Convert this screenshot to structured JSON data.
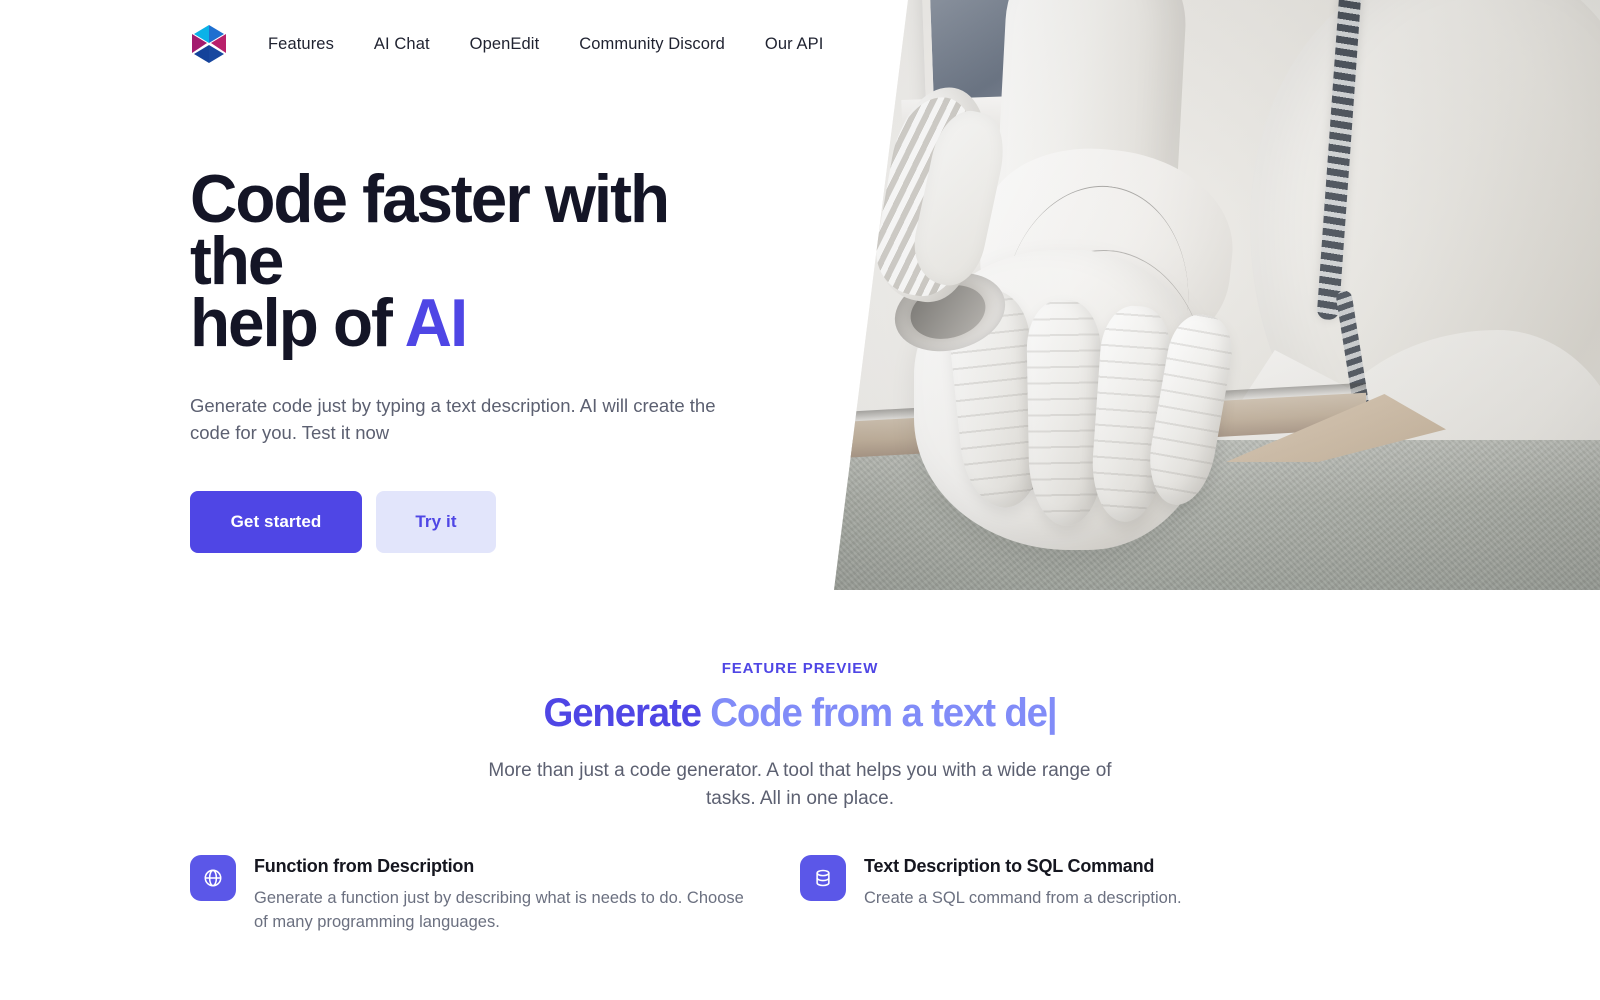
{
  "brand": {
    "logo_icon": "hexagon-prism-logo"
  },
  "nav": {
    "links": [
      {
        "label": "Features"
      },
      {
        "label": "AI Chat"
      },
      {
        "label": "OpenEdit"
      },
      {
        "label": "Community Discord"
      },
      {
        "label": "Our API"
      }
    ]
  },
  "hero": {
    "title_line1": "Code faster with the",
    "title_line2_prefix": "help of ",
    "title_highlight": "AI",
    "subtitle": "Generate code just by typing a text description. AI will create the code for you. Test it now",
    "primary_button": "Get started",
    "secondary_button": "Try it",
    "image_alt": "white-robotic-hand-photo"
  },
  "feature_preview": {
    "eyebrow": "FEATURE PREVIEW",
    "typed_static": "Generate ",
    "typed_animated": "Code from a text de",
    "caret": "|",
    "subtitle": "More than just a code generator. A tool that helps you with a wide range of tasks. All in one place."
  },
  "cards": [
    {
      "icon": "globe-icon",
      "title": "Function from Description",
      "desc": "Generate a function just by describing what is needs to do. Choose of many programming languages."
    },
    {
      "icon": "database-icon",
      "title": "Text Description to SQL Command",
      "desc": "Create a SQL command from a description."
    }
  ],
  "colors": {
    "accent": "#4f46e5",
    "accent_light": "#818cf8",
    "accent_soft_bg": "#e2e5fb",
    "heading": "#141526",
    "body_text": "#5c6071",
    "icon_tile": "#5b57e8"
  }
}
